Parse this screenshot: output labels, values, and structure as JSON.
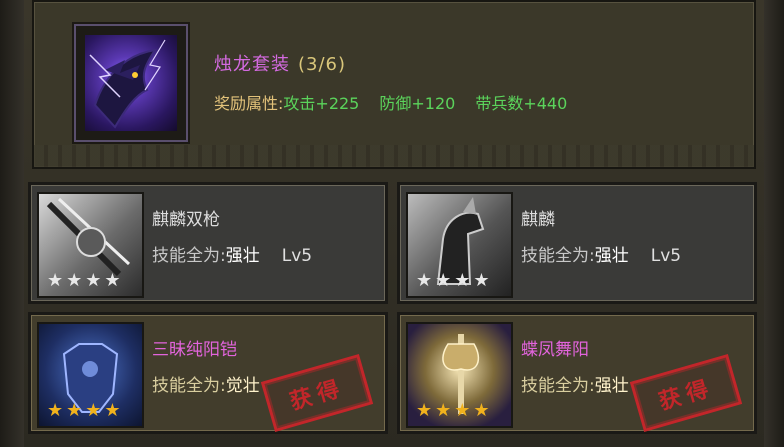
{
  "set": {
    "name": "烛龙套装",
    "count": "(3/6)",
    "attr_label": "奖励属性:",
    "attrs": [
      "攻击+225",
      "防御+120",
      "带兵数+440"
    ]
  },
  "cards": [
    {
      "name": "麒麟双枪",
      "skill_label": "技能全为:",
      "skill_value": "强壮",
      "level": "Lv5",
      "stars": 4,
      "star_color": "silver",
      "obtained": false
    },
    {
      "name": "麒麟",
      "skill_label": "技能全为:",
      "skill_value": "强壮",
      "level": "Lv5",
      "stars": 4,
      "star_color": "silver",
      "obtained": false
    },
    {
      "name": "三昧纯阳铠",
      "skill_label": "技能全为:",
      "skill_value": "觉壮",
      "level": "",
      "stars": 4,
      "star_color": "gold",
      "obtained": true,
      "stamp_text": "获得"
    },
    {
      "name": "蝶凤舞阳",
      "skill_label": "技能全为:",
      "skill_value": "强壮",
      "level": "",
      "stars": 4,
      "star_color": "gold",
      "obtained": true,
      "stamp_text": "获得"
    }
  ],
  "colors": {
    "set_name": "#d46ae0",
    "attr_green": "#5bd35b",
    "stamp_red": "#c2262a",
    "star_gold": "#f1b21d",
    "star_silver": "#e8e8e8"
  }
}
